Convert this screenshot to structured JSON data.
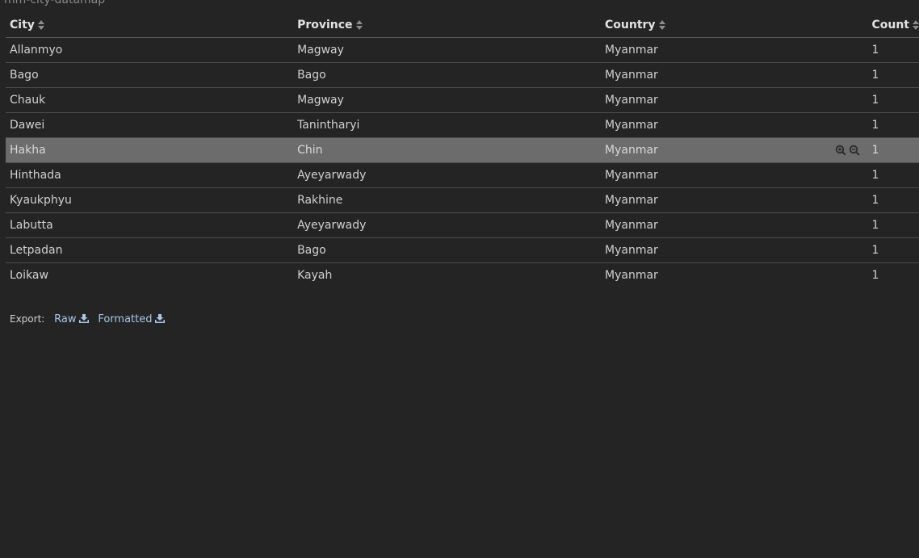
{
  "panel": {
    "title": "mm-city-datamap"
  },
  "table": {
    "columns": [
      {
        "label": "City"
      },
      {
        "label": "Province"
      },
      {
        "label": "Country"
      },
      {
        "label": "Count"
      }
    ],
    "rows": [
      {
        "city": "Allanmyo",
        "province": "Magway",
        "country": "Myanmar",
        "count": "1"
      },
      {
        "city": "Bago",
        "province": "Bago",
        "country": "Myanmar",
        "count": "1"
      },
      {
        "city": "Chauk",
        "province": "Magway",
        "country": "Myanmar",
        "count": "1"
      },
      {
        "city": "Dawei",
        "province": "Tanintharyi",
        "country": "Myanmar",
        "count": "1"
      },
      {
        "city": "Hakha",
        "province": "Chin",
        "country": "Myanmar",
        "count": "1"
      },
      {
        "city": "Hinthada",
        "province": "Ayeyarwady",
        "country": "Myanmar",
        "count": "1"
      },
      {
        "city": "Kyaukphyu",
        "province": "Rakhine",
        "country": "Myanmar",
        "count": "1"
      },
      {
        "city": "Labutta",
        "province": "Ayeyarwady",
        "country": "Myanmar",
        "count": "1"
      },
      {
        "city": "Letpadan",
        "province": "Bago",
        "country": "Myanmar",
        "count": "1"
      },
      {
        "city": "Loikaw",
        "province": "Kayah",
        "country": "Myanmar",
        "count": "1"
      }
    ]
  },
  "export": {
    "label": "Export:",
    "raw": "Raw",
    "formatted": "Formatted"
  },
  "colors": {
    "background": "#242424",
    "highlight_row": "#6c6c6c",
    "link": "#a9c7e8"
  },
  "icons": [
    "sort-icon",
    "zoom-in-icon",
    "zoom-out-icon",
    "download-icon"
  ]
}
